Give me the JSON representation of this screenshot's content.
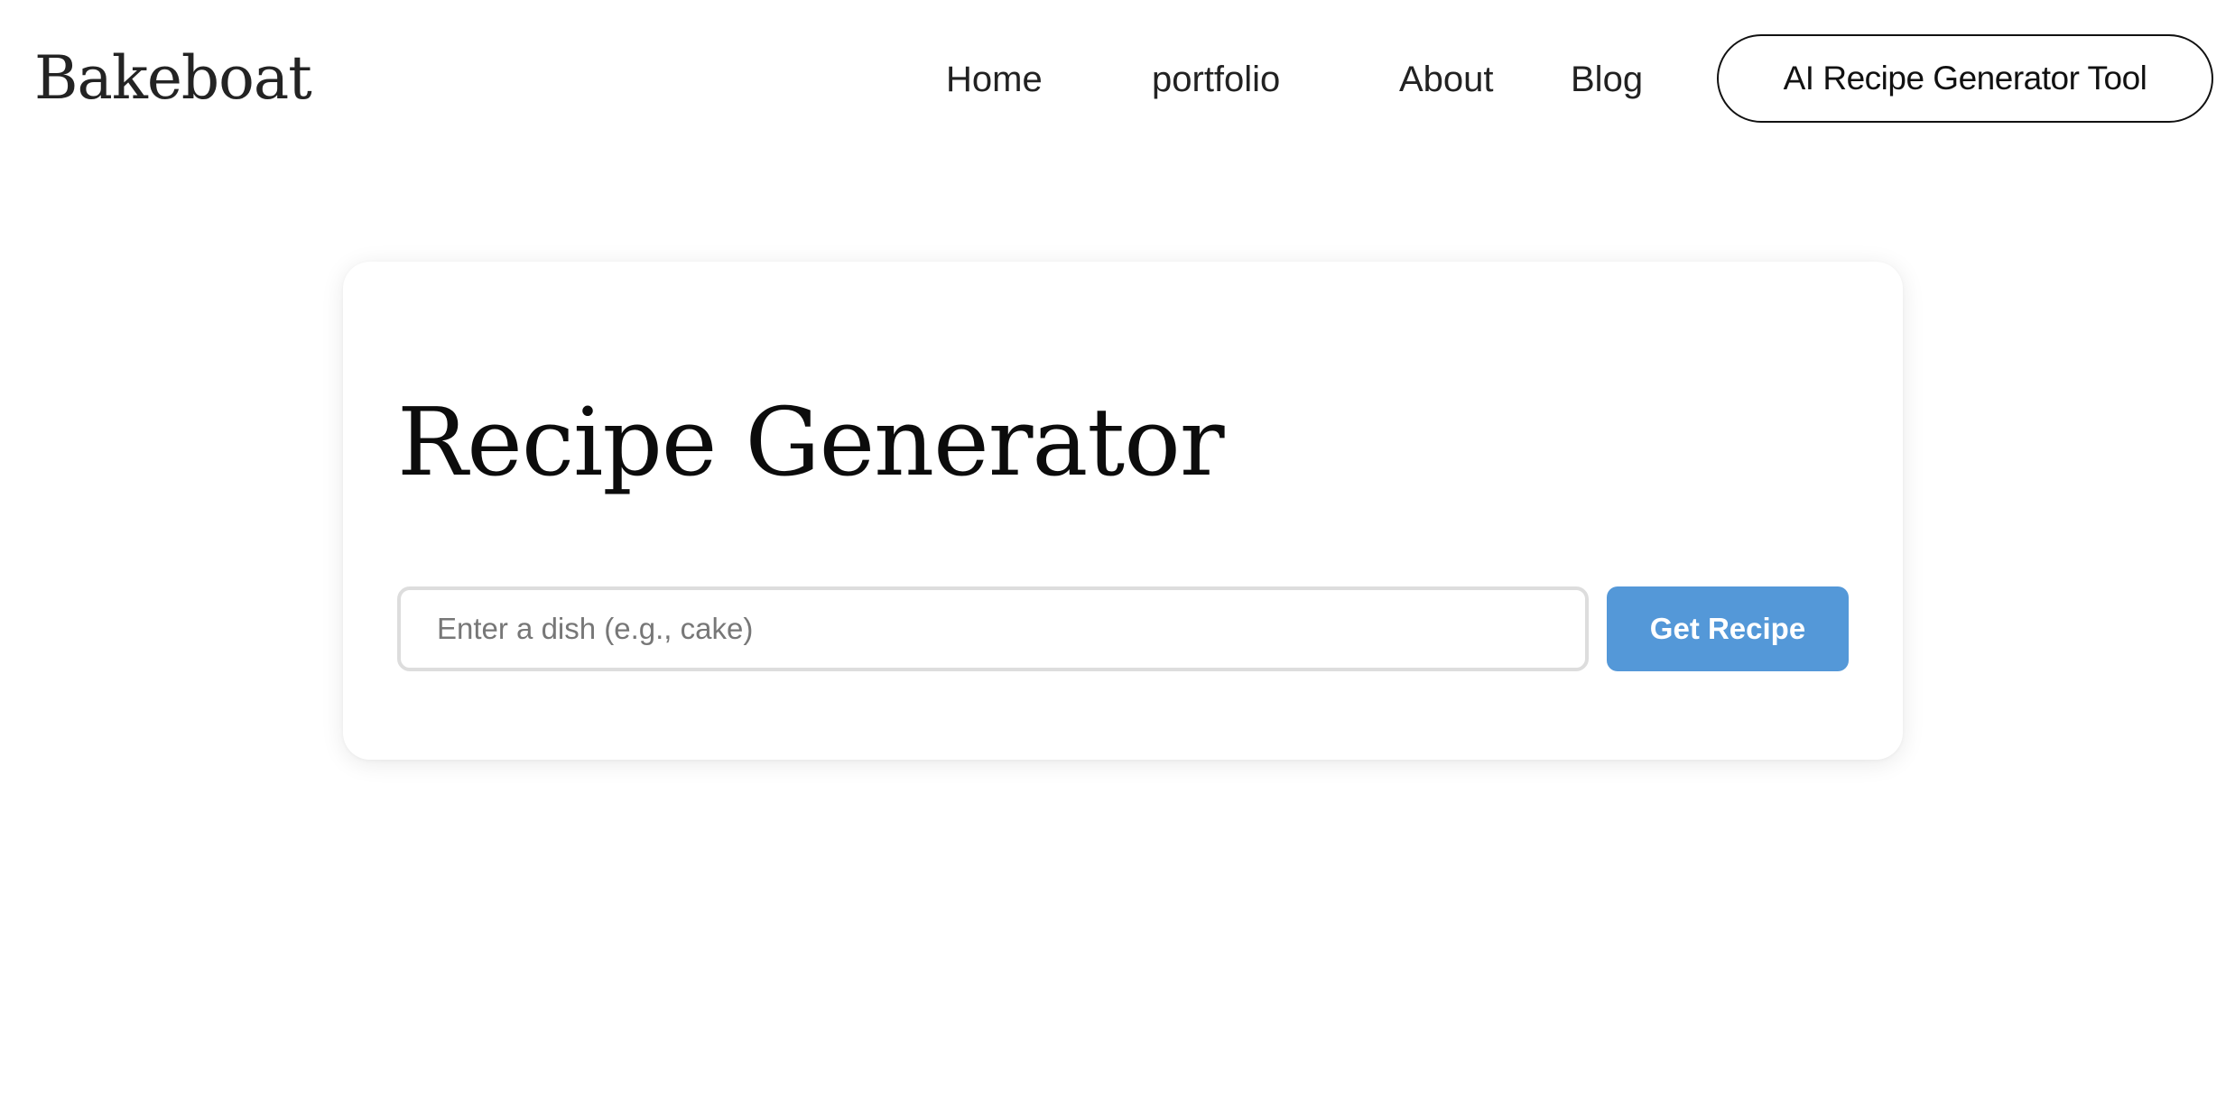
{
  "header": {
    "logo": "Bakeboat",
    "nav": {
      "home": "Home",
      "portfolio": "portfolio",
      "about": "About",
      "blog": "Blog"
    },
    "cta_label": "AI Recipe Generator Tool"
  },
  "main": {
    "title": "Recipe Generator",
    "search": {
      "value": "",
      "placeholder": "Enter a dish (e.g., cake)"
    },
    "submit_label": "Get Recipe"
  },
  "colors": {
    "accent": "#5498d8",
    "text": "#222222",
    "input_border": "#dddddd"
  }
}
